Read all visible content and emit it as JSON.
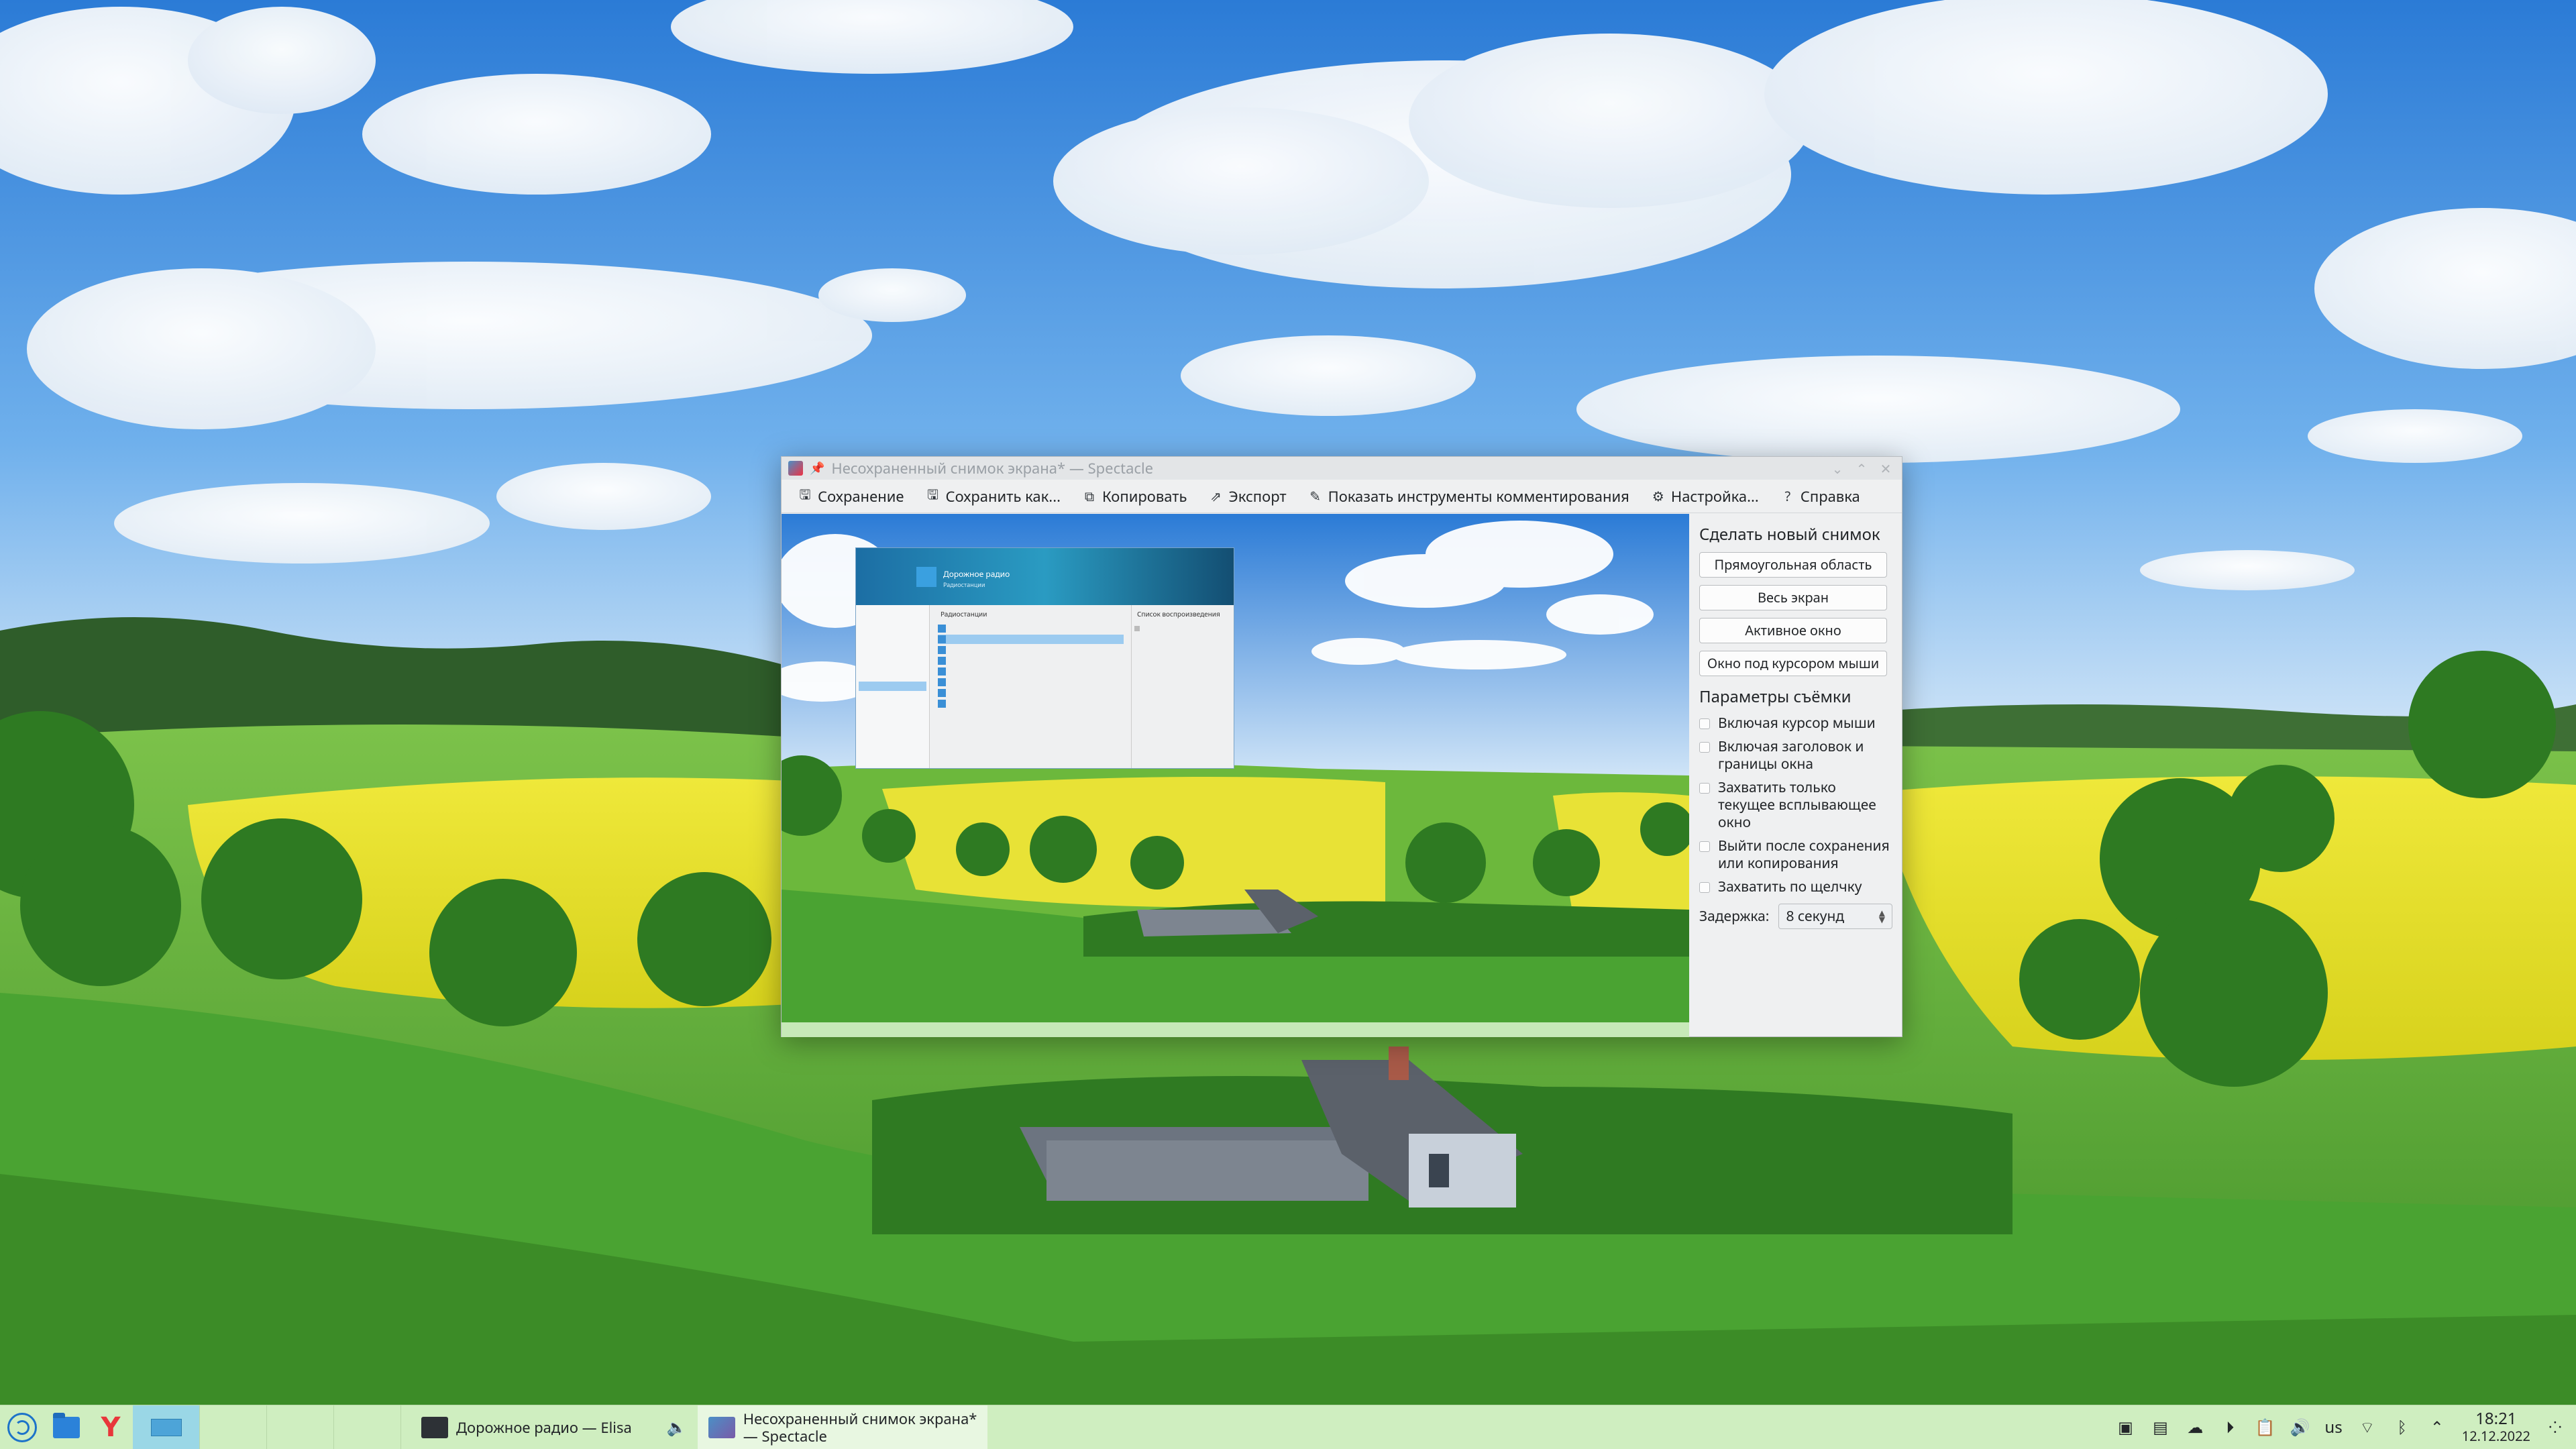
{
  "window": {
    "title": "Несохраненный снимок экрана* — Spectacle",
    "toolbar": {
      "save": "Сохранение",
      "save_as": "Сохранить как...",
      "copy": "Копировать",
      "export": "Экспорт",
      "annotate": "Показать инструменты комментирования",
      "configure": "Настройка...",
      "help": "Справка"
    },
    "panel": {
      "new_heading": "Сделать новый снимок",
      "modes": [
        "Прямоугольная область",
        "Весь экран",
        "Активное окно",
        "Окно под курсором мыши"
      ],
      "options_heading": "Параметры съёмки",
      "options": [
        "Включая курсор мыши",
        "Включая заголовок и границы окна",
        "Захватить только текущее всплывающее окно",
        "Выйти после сохранения или копирования",
        "Захватить по щелчку"
      ],
      "delay_label": "Задержка:",
      "delay_value": "8 секунд"
    },
    "preview": {
      "mini_title": "Дорожное радио",
      "mini_subtitle": "Радиостанции",
      "mini_list_header": "Радиостанции",
      "mini_playlist_header": "Список воспроизведения"
    }
  },
  "taskbar": {
    "tasks": [
      {
        "label": "Дорожное радио — Elisa"
      },
      {
        "label_line1": "Несохраненный снимок экрана*",
        "label_line2": "— Spectacle"
      }
    ],
    "tray": {
      "keyboard_layout": "us",
      "time": "18:21",
      "date": "12.12.2022"
    }
  }
}
